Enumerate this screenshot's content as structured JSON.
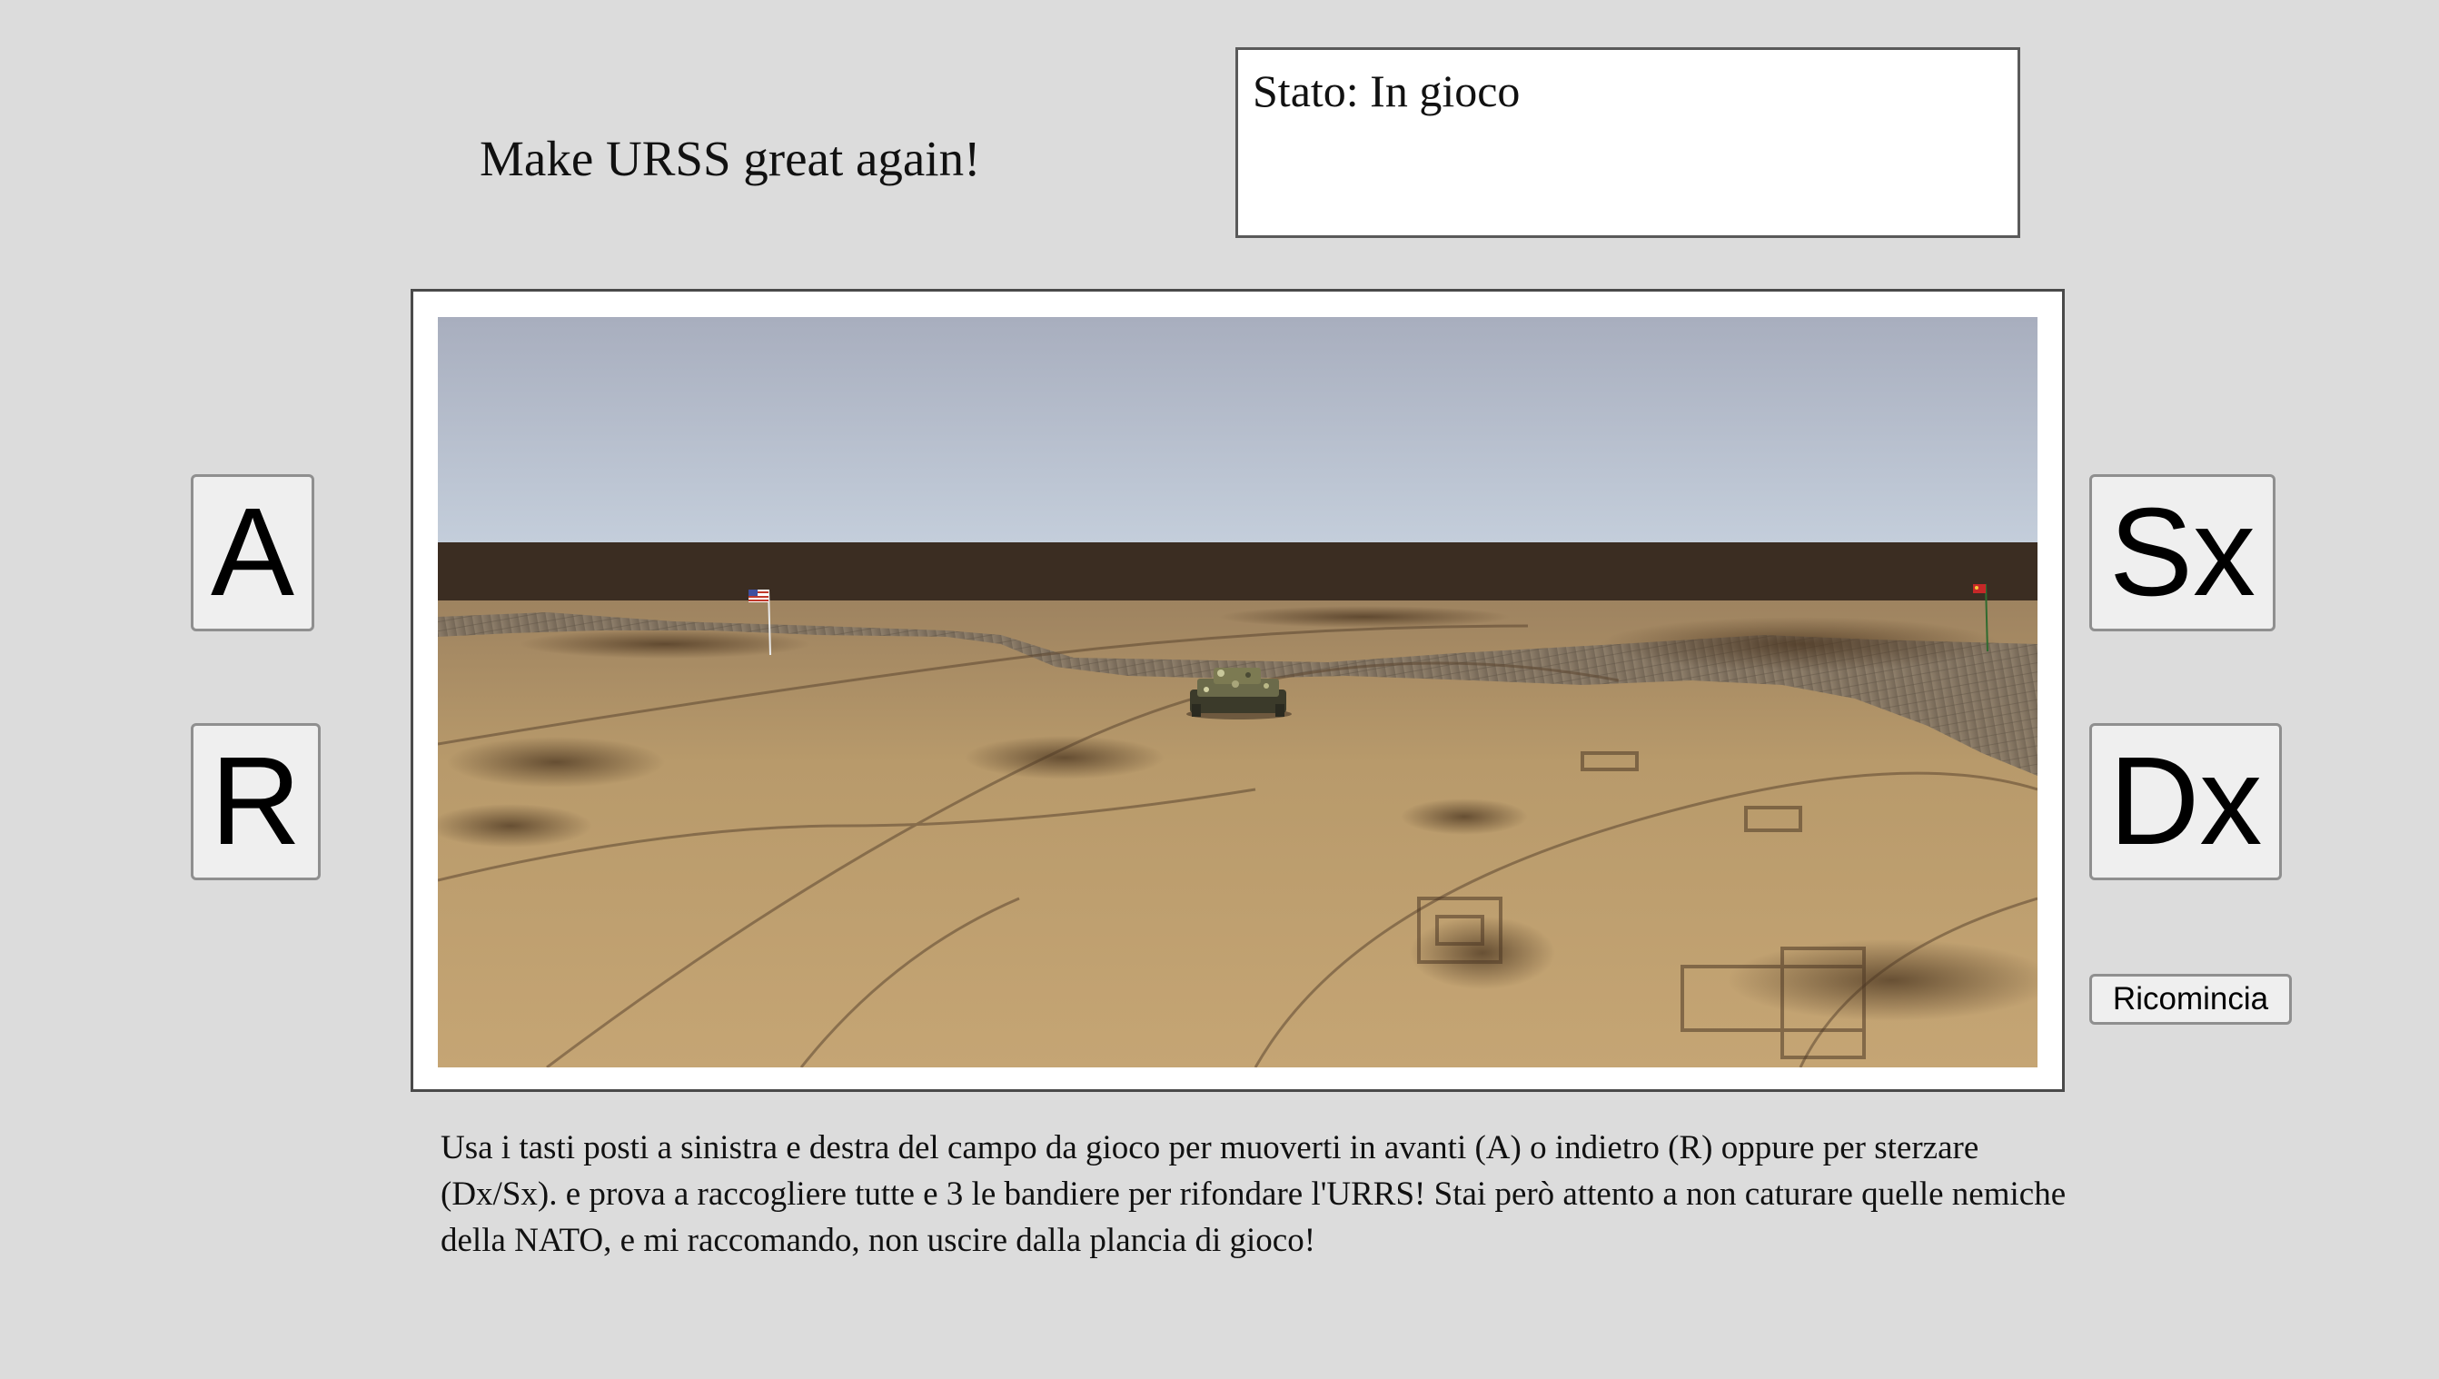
{
  "header": {
    "title": "Make URSS great again!"
  },
  "status": {
    "text": "Stato: In gioco"
  },
  "controls": {
    "forward_label": "A",
    "backward_label": "R",
    "left_label": "Sx",
    "right_label": "Dx",
    "restart_label": "Ricomincia"
  },
  "instructions": {
    "text": "Usa i tasti posti a sinistra e destra del campo da gioco per muoverti in avanti (A) o indietro (R) oppure per sterzare (Dx/Sx). e prova a raccogliere tutte e 3 le bandiere per rifondare l'URRS! Stai però attento a non caturare quelle nemiche della NATO, e mi raccomando, non uscire dalla plancia di gioco!"
  },
  "scene": {
    "sky_top_color": "#a9b0c0",
    "sky_bottom_color": "#c5d0dd",
    "horizon_wall_color": "#3a2c22",
    "ground_color": "#b89968",
    "river_color": "#7e7060",
    "enemy_flag": "nato-flag",
    "friendly_flag": "soviet-flag",
    "player": "tank"
  }
}
